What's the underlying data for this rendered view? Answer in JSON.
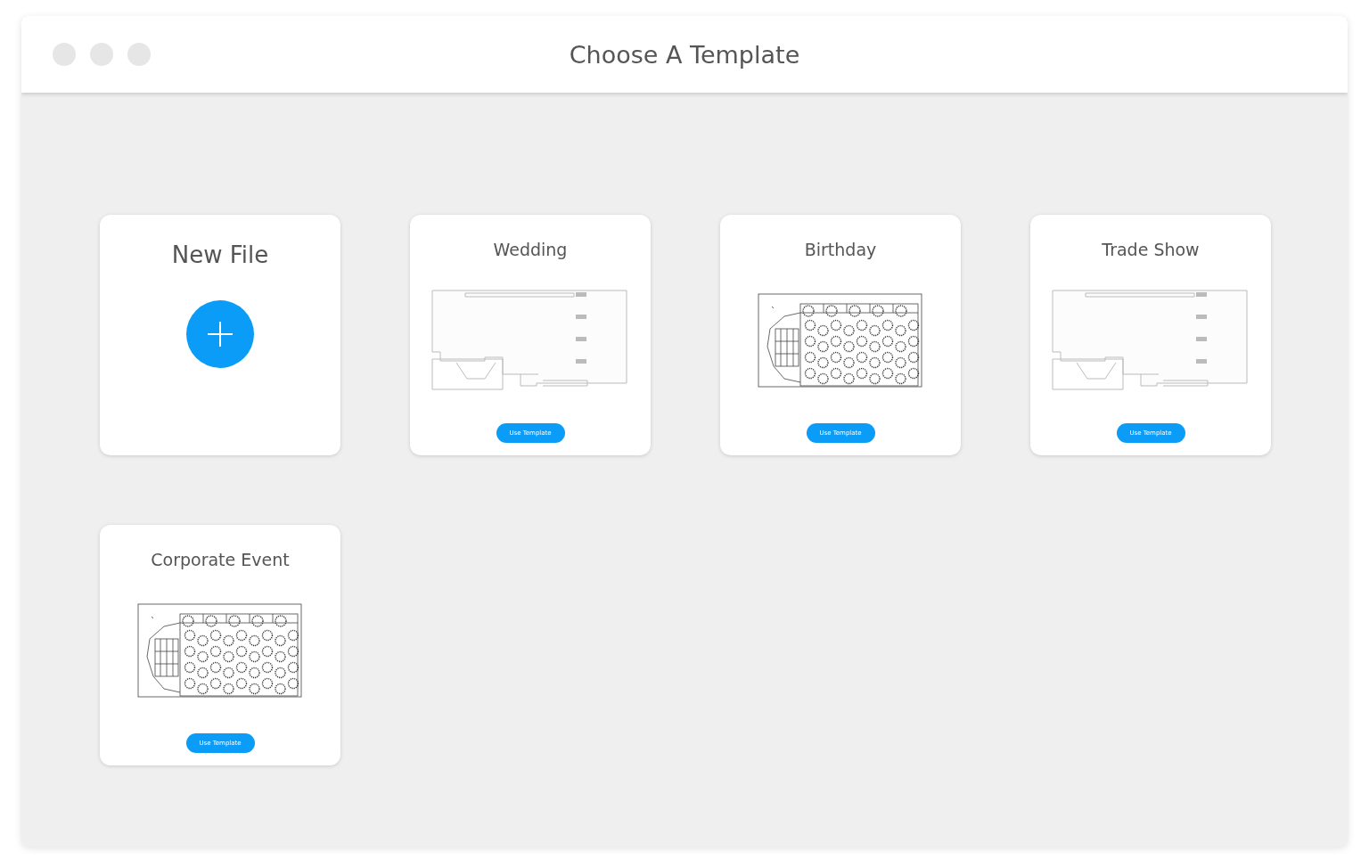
{
  "window": {
    "title": "Choose A Template"
  },
  "cards": [
    {
      "kind": "new",
      "title": "New File"
    },
    {
      "kind": "hall",
      "title": "Wedding",
      "button": "Use Template"
    },
    {
      "kind": "banquet",
      "title": "Birthday",
      "button": "Use Template"
    },
    {
      "kind": "hall",
      "title": "Trade Show",
      "button": "Use Template"
    },
    {
      "kind": "banquet",
      "title": "Corporate Event",
      "button": "Use Template"
    }
  ]
}
